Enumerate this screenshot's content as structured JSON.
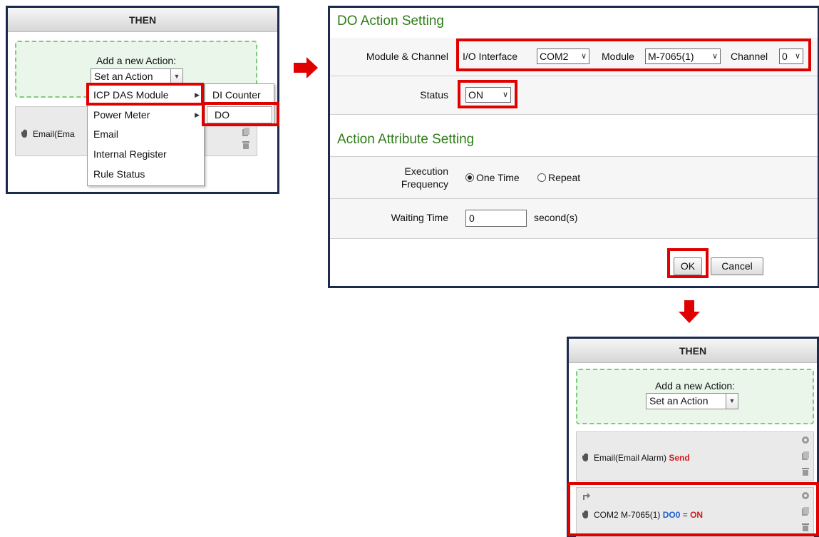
{
  "then_panel": {
    "title": "THEN",
    "add_action_label": "Add a new Action:",
    "select_value": "Set an Action",
    "existing_row_text": "Email(Ema"
  },
  "action_menu": {
    "items": [
      {
        "label": "ICP DAS Module",
        "has_submenu": true
      },
      {
        "label": "Power Meter",
        "has_submenu": true
      },
      {
        "label": "Email",
        "has_submenu": false
      },
      {
        "label": "Internal Register",
        "has_submenu": false
      },
      {
        "label": "Rule Status",
        "has_submenu": false
      }
    ],
    "submenu": [
      {
        "label": "DI Counter"
      },
      {
        "label": "DO"
      }
    ]
  },
  "do_panel": {
    "title": "DO Action Setting",
    "module_channel_label": "Module & Channel",
    "io_interface_label": "I/O Interface",
    "io_interface_value": "COM2",
    "module_label": "Module",
    "module_value": "M-7065(1)",
    "channel_label": "Channel",
    "channel_value": "0",
    "status_label": "Status",
    "status_value": "ON",
    "attr_title": "Action Attribute Setting",
    "exec_label_line1": "Execution",
    "exec_label_line2": "Frequency",
    "exec_option_1": "One Time",
    "exec_option_2": "Repeat",
    "exec_selected": "One Time",
    "waiting_label": "Waiting Time",
    "waiting_value": "0",
    "waiting_unit": "second(s)",
    "ok_label": "OK",
    "cancel_label": "Cancel"
  },
  "result_panel": {
    "title": "THEN",
    "add_action_label": "Add a new Action:",
    "select_value": "Set an Action",
    "row1": {
      "prefix": "Email(Email Alarm)",
      "action": "Send"
    },
    "row2": {
      "prefix": "COM2 M-7065(1)",
      "channel": "DO0",
      "eq": "=",
      "value": "ON"
    }
  },
  "colors": {
    "highlight": "#e10000",
    "panel_border": "#1c2a4d",
    "section_title": "#2e7d18",
    "arrow": "#e10000"
  }
}
